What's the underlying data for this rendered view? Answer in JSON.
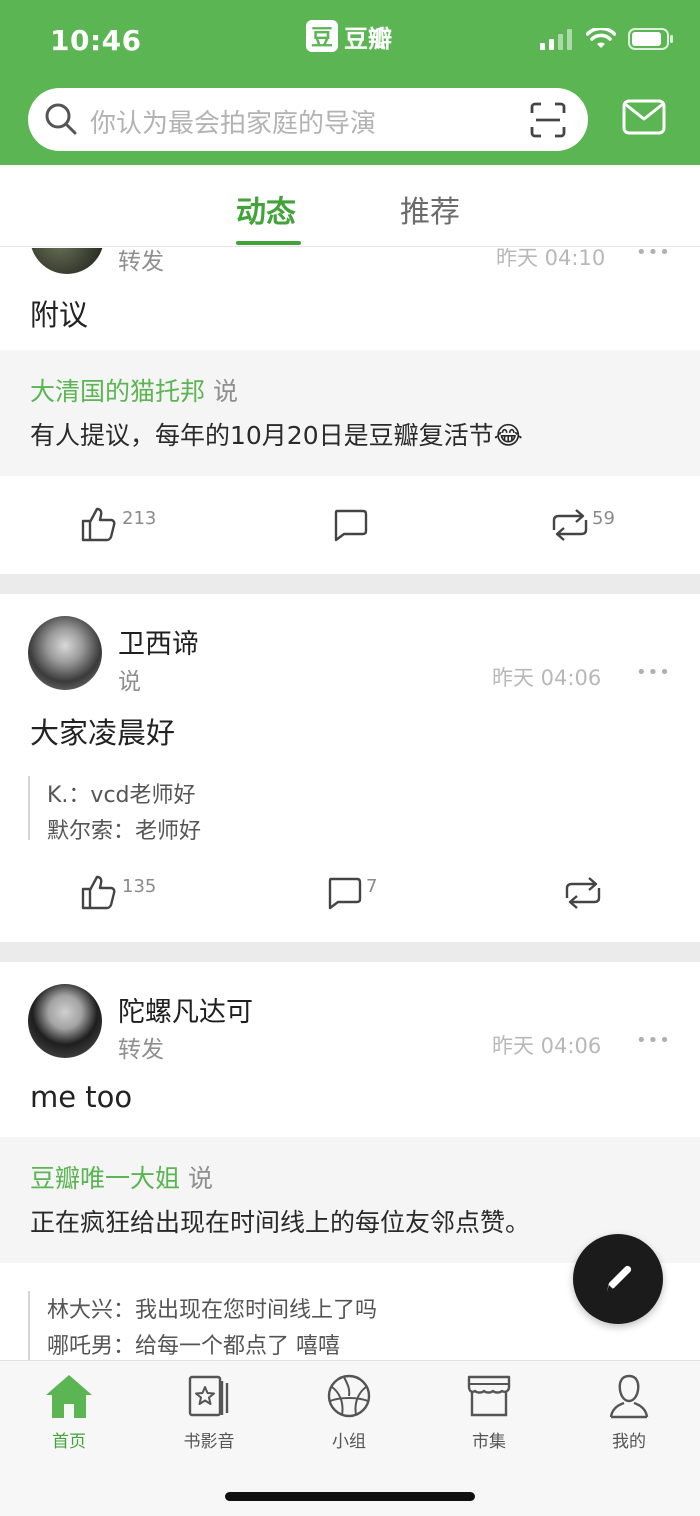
{
  "status_bar": {
    "time": "10:46"
  },
  "app": {
    "logo_glyph": "豆",
    "name": "豆瓣",
    "brand_color": "#5ab552"
  },
  "search": {
    "placeholder": "你认为最会拍家庭的导演"
  },
  "tabs": [
    {
      "label": "动态",
      "active": true
    },
    {
      "label": "推荐",
      "active": false
    }
  ],
  "feed": {
    "post1": {
      "action": "转发",
      "time": "昨天 04:10",
      "more": "•••",
      "text": "附议",
      "original": {
        "author": "大清国的猫托邦",
        "said": "说",
        "text": "有人提议，每年的10月20日是豆瓣复活节😂"
      },
      "likes": "213",
      "reposts": "59"
    },
    "post2": {
      "user": "卫西谛",
      "action": "说",
      "time": "昨天 04:06",
      "more": "•••",
      "text": "大家凌晨好",
      "comments_preview": [
        "K.：vcd老师好",
        "默尔索：老师好"
      ],
      "likes": "135",
      "comments": "7"
    },
    "post3": {
      "user": "陀螺凡达可",
      "action": "转发",
      "time": "昨天 04:06",
      "more": "•••",
      "text": "me too",
      "original": {
        "author": "豆瓣唯一大姐",
        "said": "说",
        "text": "正在疯狂给出现在时间线上的每位友邻点赞。"
      },
      "comments_preview": [
        "林大兴：我出现在您时间线上了吗",
        "哪吒男：给每一个都点了 嘻嘻"
      ]
    }
  },
  "bottom_nav": [
    {
      "label": "首页",
      "icon": "home-icon",
      "active": true
    },
    {
      "label": "书影音",
      "icon": "book-movie-music-icon",
      "active": false
    },
    {
      "label": "小组",
      "icon": "group-icon",
      "active": false
    },
    {
      "label": "市集",
      "icon": "market-icon",
      "active": false
    },
    {
      "label": "我的",
      "icon": "profile-icon",
      "active": false
    }
  ]
}
